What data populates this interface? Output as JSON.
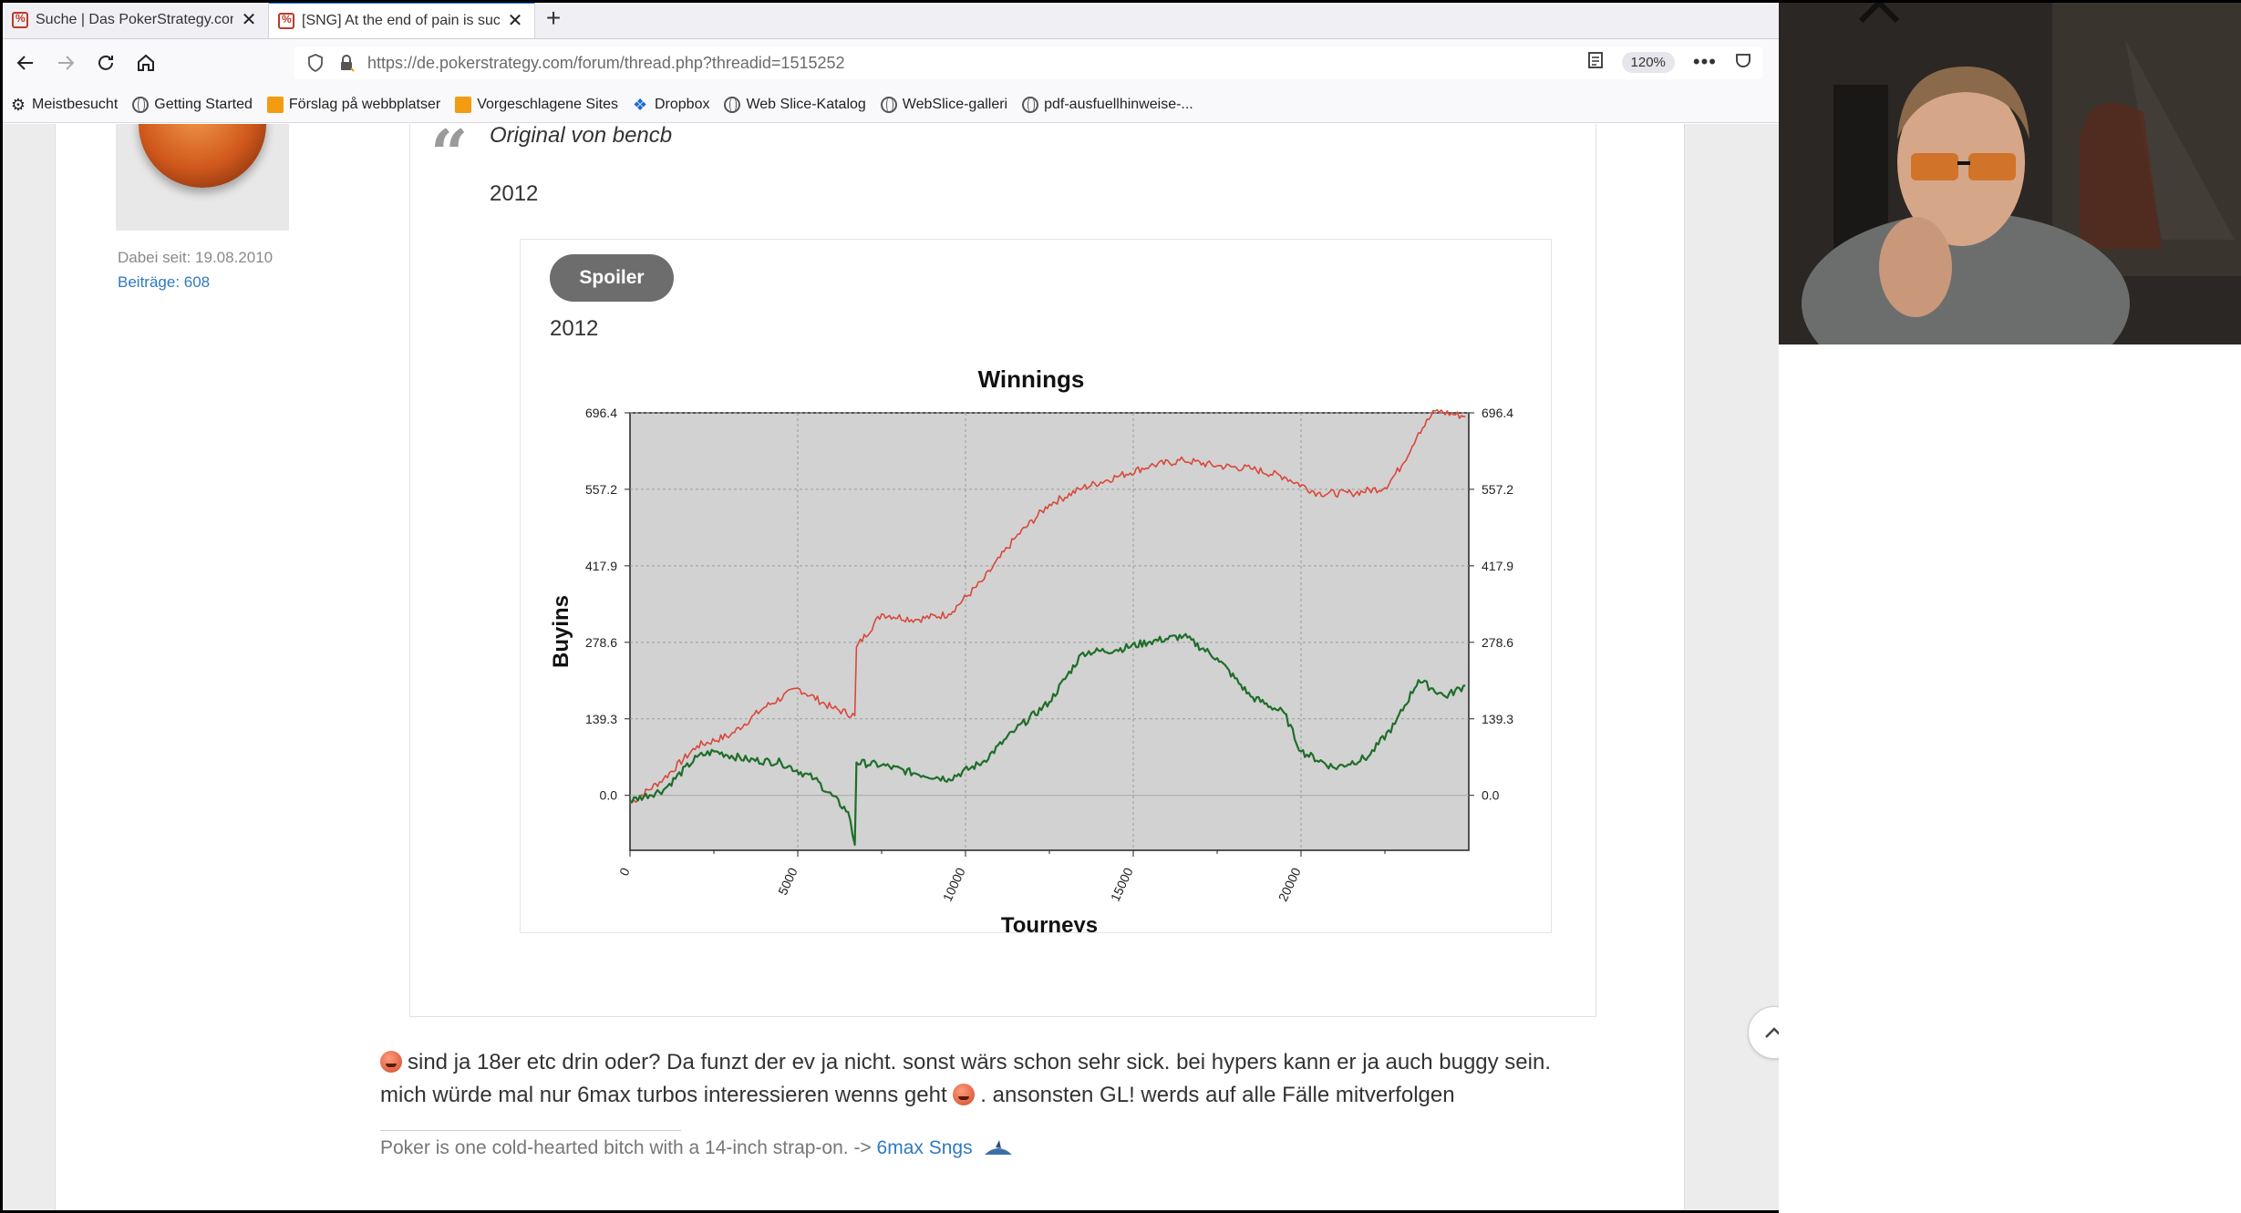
{
  "browser": {
    "tabs": [
      {
        "title": "Suche | Das PokerStrategy.com",
        "active": false
      },
      {
        "title": "[SNG] At the end of pain is suc",
        "active": true
      }
    ],
    "url": "https://de.pokerstrategy.com/forum/thread.php?threadid=1515252",
    "zoom": "120%",
    "bookmarks": [
      {
        "label": "Meistbesucht",
        "icon": "gear-icon"
      },
      {
        "label": "Getting Started",
        "icon": "globe-icon"
      },
      {
        "label": "Förslag på webbplatser",
        "icon": "flag-icon"
      },
      {
        "label": "Vorgeschlagene Sites",
        "icon": "flag-icon"
      },
      {
        "label": "Dropbox",
        "icon": "dropbox-icon"
      },
      {
        "label": "Web Slice-Katalog",
        "icon": "globe-icon"
      },
      {
        "label": "WebSlice-galleri",
        "icon": "globe-icon"
      },
      {
        "label": "pdf-ausfuellhinweise-...",
        "icon": "globe-icon"
      }
    ]
  },
  "user": {
    "member_since": "Dabei seit: 19.08.2010",
    "posts": "Beiträge: 608"
  },
  "quote": {
    "author": "Original von bencb",
    "year": "2012",
    "spoiler_label": "Spoiler",
    "spoiler_year": "2012"
  },
  "chart_data": {
    "type": "line",
    "title": "Winnings",
    "xlabel": "Tourneys",
    "ylabel": "Buyins",
    "xlim": [
      0,
      25000
    ],
    "ylim": [
      -100,
      696.4
    ],
    "x_ticks": [
      "0",
      "5000",
      "10000",
      "15000",
      "20000"
    ],
    "y_ticks": [
      "0.0",
      "139.3",
      "278.6",
      "417.9",
      "557.2",
      "696.4"
    ],
    "grid": true,
    "series": [
      {
        "color": "#d9483a",
        "x": [
          0,
          1000,
          2000,
          3000,
          4000,
          5000,
          6000,
          6700,
          6750,
          7500,
          8500,
          9500,
          10500,
          11500,
          12500,
          13500,
          14500,
          15500,
          16500,
          17500,
          18500,
          19500,
          20500,
          21500,
          22500,
          23000,
          23500,
          24000,
          24900
        ],
        "y": [
          -15,
          30,
          90,
          110,
          160,
          195,
          160,
          145,
          270,
          330,
          320,
          330,
          390,
          470,
          530,
          560,
          580,
          600,
          610,
          600,
          595,
          580,
          550,
          550,
          560,
          600,
          660,
          700,
          690
        ]
      },
      {
        "color": "#1f6e2a",
        "x": [
          0,
          1000,
          2000,
          2500,
          3500,
          4500,
          5500,
          6500,
          6700,
          6750,
          7500,
          8500,
          9500,
          10500,
          11500,
          12500,
          13500,
          14500,
          15500,
          16500,
          17500,
          18500,
          19500,
          20000,
          21000,
          22000,
          22800,
          23500,
          24300,
          24900
        ],
        "y": [
          -10,
          10,
          70,
          80,
          65,
          60,
          30,
          -30,
          -90,
          60,
          55,
          40,
          30,
          60,
          120,
          170,
          260,
          265,
          280,
          290,
          250,
          180,
          150,
          80,
          50,
          70,
          130,
          210,
          180,
          200
        ]
      }
    ]
  },
  "reply": {
    "line1": "sind ja 18er etc drin oder? Da funzt der ev ja nicht. sonst wärs schon sehr sick. bei hypers kann er ja auch buggy sein.",
    "line2a": "mich würde mal nur 6max turbos interessieren wenns geht",
    "line2b": ". ansonsten GL! werds auf alle Fälle mitverfolgen"
  },
  "signature": {
    "text": "Poker is one cold-hearted bitch with a 14-inch strap-on. -> ",
    "link": "6max Sngs"
  },
  "colors": {
    "accent_tab": "#0a84ff",
    "link": "#2f7ac0",
    "chart_bg": "#d2d2d2"
  }
}
